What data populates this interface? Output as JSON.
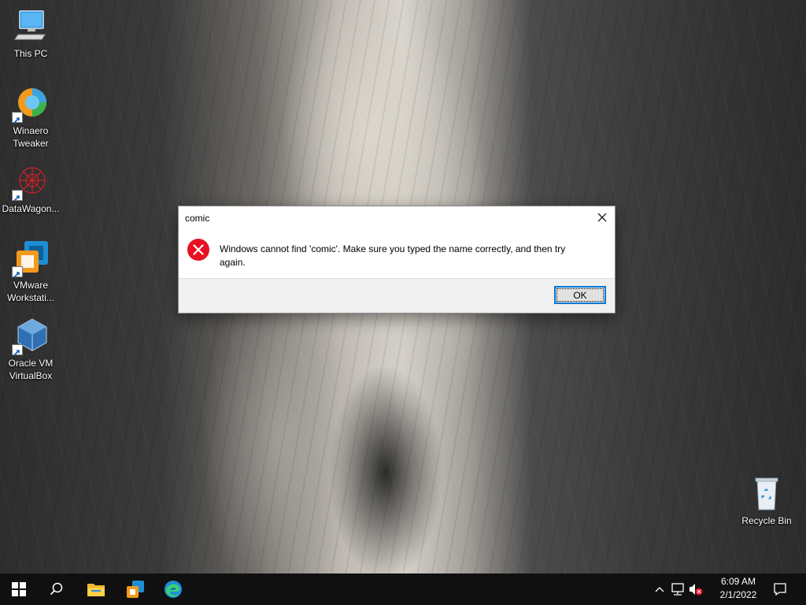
{
  "desktop": {
    "icons": [
      {
        "label": "This PC",
        "icon": "this-pc-icon"
      },
      {
        "label": "Winaero Tweaker",
        "icon": "winaero-tweaker-icon"
      },
      {
        "label": "DataWagon...",
        "icon": "datawagon-icon"
      },
      {
        "label": "VMware Workstati...",
        "icon": "vmware-workstation-icon"
      },
      {
        "label": "Oracle VM VirtualBox",
        "icon": "oracle-vm-virtualbox-icon"
      },
      {
        "label": "Recycle Bin",
        "icon": "recycle-bin-icon"
      }
    ]
  },
  "dialog": {
    "title": "comic",
    "message": "Windows cannot find 'comic'. Make sure you typed the name correctly, and then try again.",
    "ok_label": "OK",
    "icon": "error-icon"
  },
  "taskbar": {
    "buttons": [
      {
        "name": "start-button",
        "icon": "windows-logo-icon"
      },
      {
        "name": "search-button",
        "icon": "search-icon"
      },
      {
        "name": "file-explorer-button",
        "icon": "folder-icon"
      },
      {
        "name": "vmware-taskbar-button",
        "icon": "vmware-icon"
      },
      {
        "name": "edge-button",
        "icon": "edge-icon"
      }
    ],
    "tray": {
      "time": "6:09 AM",
      "date": "2/1/2022",
      "icons": [
        "chevron-up-icon",
        "network-icon",
        "volume-muted-icon",
        "notification-icon"
      ]
    }
  },
  "colors": {
    "accent": "#0078d7",
    "error_red": "#e81123",
    "taskbar_bg": "#101010"
  }
}
